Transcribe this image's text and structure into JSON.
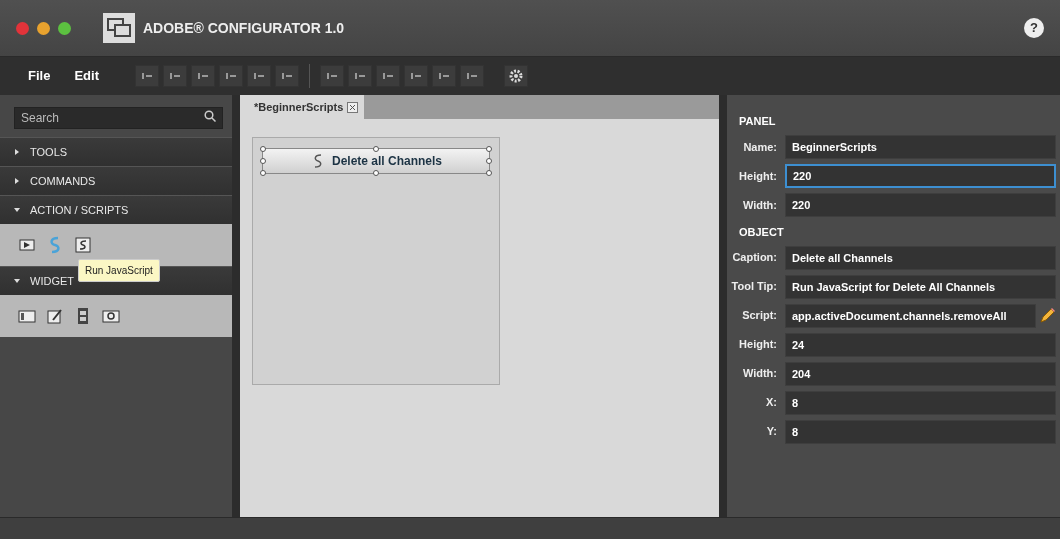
{
  "window": {
    "title": "ADOBE® CONFIGURATOR 1.0",
    "help": "?"
  },
  "menu": [
    "File",
    "Edit"
  ],
  "sidebar": {
    "search": {
      "placeholder": "Search"
    },
    "sections": [
      {
        "label": "TOOLS",
        "expanded": false
      },
      {
        "label": "COMMANDS",
        "expanded": false
      },
      {
        "label": "ACTION / SCRIPTS",
        "expanded": true,
        "items": [
          {
            "kind": "panel",
            "hovered": false
          },
          {
            "kind": "script",
            "hovered": true
          },
          {
            "kind": "scriptfile",
            "hovered": false
          }
        ]
      },
      {
        "label": "WIDGET",
        "expanded": true,
        "items": [
          {
            "kind": "frame",
            "hovered": false
          },
          {
            "kind": "edit",
            "hovered": false
          },
          {
            "kind": "film",
            "hovered": false
          },
          {
            "kind": "image",
            "hovered": false
          }
        ]
      }
    ],
    "tooltip": "Run JavaScript"
  },
  "tabs": [
    {
      "label": "*BeginnerScripts",
      "selected": true
    }
  ],
  "canvas": {
    "button_caption": "Delete all Channels"
  },
  "properties": [
    {
      "title": "PANEL",
      "fields": [
        {
          "label": "Name:",
          "value": "BeginnerScripts",
          "focused": false,
          "kind": "text"
        },
        {
          "label": "Height:",
          "value": "220",
          "focused": true,
          "kind": "text"
        },
        {
          "label": "Width:",
          "value": "220",
          "focused": false,
          "kind": "text"
        }
      ]
    },
    {
      "title": "OBJECT",
      "fields": [
        {
          "label": "Caption:",
          "value": "Delete all Channels",
          "focused": false,
          "kind": "text"
        },
        {
          "label": "Tool Tip:",
          "value": "Run JavaScript for Delete All Channels",
          "focused": false,
          "kind": "text"
        },
        {
          "label": "Script:",
          "value": "app.activeDocument.channels.removeAll",
          "focused": false,
          "kind": "script"
        },
        {
          "label": "Height:",
          "value": "24",
          "focused": false,
          "kind": "text"
        },
        {
          "label": "Width:",
          "value": "204",
          "focused": false,
          "kind": "text"
        },
        {
          "label": "X:",
          "value": "8",
          "focused": false,
          "kind": "text"
        },
        {
          "label": "Y:",
          "value": "8",
          "focused": false,
          "kind": "text"
        }
      ]
    }
  ]
}
